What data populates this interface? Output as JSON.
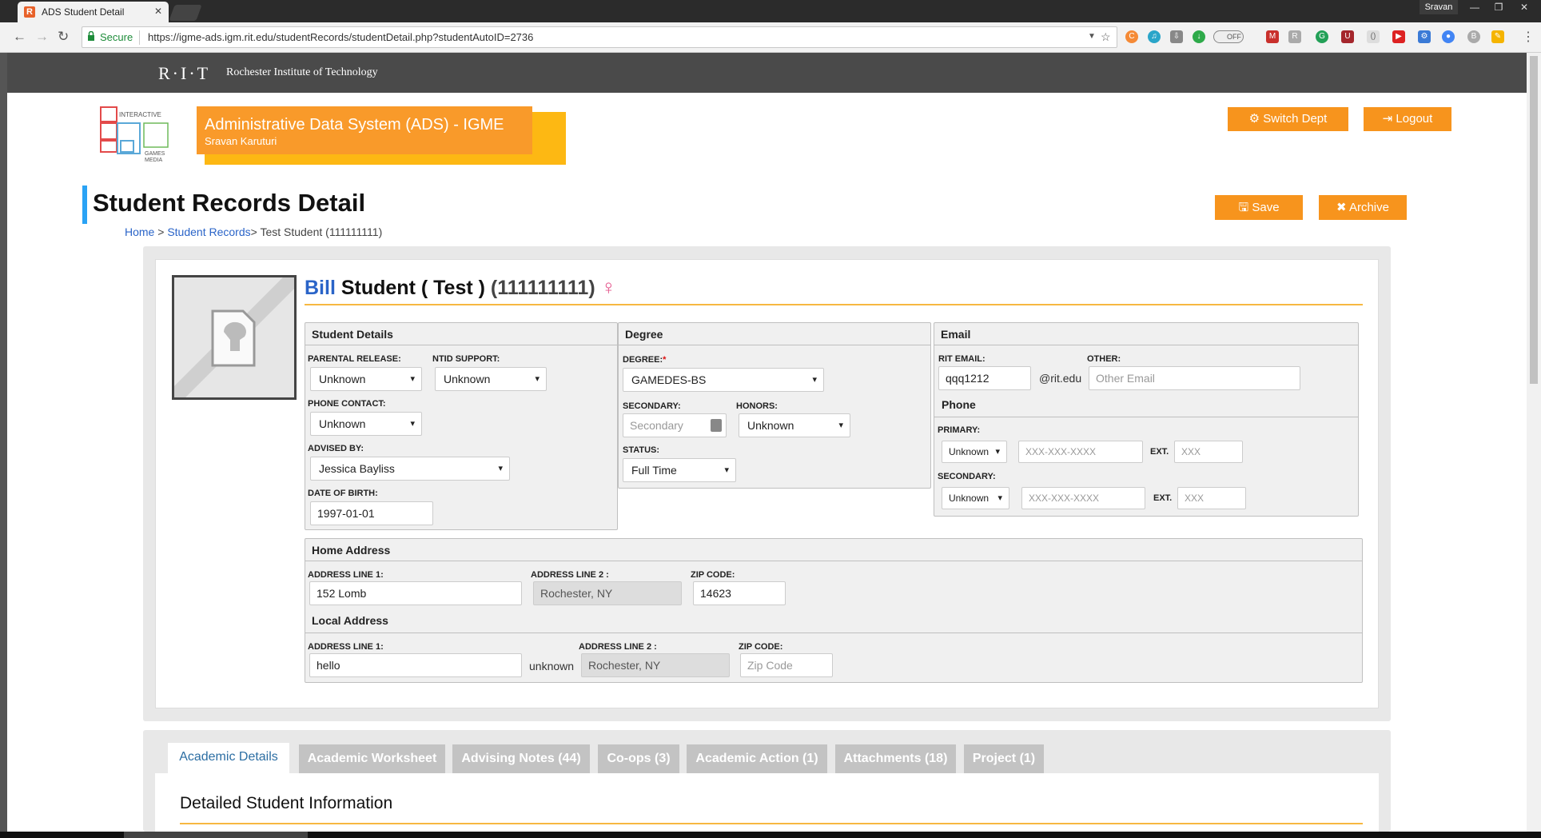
{
  "browser": {
    "tab_title": "ADS Student Detail",
    "tab_favicon": "R",
    "user": "Sravan",
    "secure_label": "Secure",
    "url": "https://igme-ads.igm.rit.edu/studentRecords/studentDetail.php?studentAutoID=2736",
    "toggle_label": "OFF"
  },
  "rit": {
    "logo": "R·I·T",
    "name": "Rochester Institute of Technology"
  },
  "header": {
    "igm_logo_lines": [
      "INTERACTIVE",
      "GAMES",
      "MEDIA"
    ],
    "system_title": "Administrative Data System (ADS) - IGME",
    "user_name": "Sravan Karuturi",
    "switch_dept": "Switch Dept",
    "logout": "Logout"
  },
  "page": {
    "title": "Student Records Detail",
    "breadcrumb_home": "Home",
    "breadcrumb_sep1": " > ",
    "breadcrumb_records": "Student Records",
    "breadcrumb_current": "> Test Student (111111111)",
    "save": "Save",
    "archive": "Archive"
  },
  "student": {
    "first_name": "Bill",
    "last_name": "Student ( Test )",
    "id": "(111111111)",
    "gender_symbol": "♀"
  },
  "student_details": {
    "heading": "Student Details",
    "parental_release_label": "PARENTAL RELEASE:",
    "parental_release": "Unknown",
    "ntid_support_label": "NTID SUPPORT:",
    "ntid_support": "Unknown",
    "phone_contact_label": "PHONE CONTACT:",
    "phone_contact": "Unknown",
    "advised_by_label": "ADVISED BY:",
    "advised_by": "Jessica Bayliss",
    "dob_label": "DATE OF BIRTH:",
    "dob": "1997-01-01"
  },
  "degree": {
    "heading": "Degree",
    "degree_label": "DEGREE:",
    "required_mark": "*",
    "degree": "GAMEDES-BS",
    "secondary_label": "SECONDARY:",
    "secondary_placeholder": "Secondary",
    "honors_label": "HONORS:",
    "honors": "Unknown",
    "status_label": "STATUS:",
    "status": "Full Time"
  },
  "email": {
    "heading": "Email",
    "rit_email_label": "RIT EMAIL:",
    "rit_email": "qqq1212",
    "domain": "@rit.edu",
    "other_label": "OTHER:",
    "other_placeholder": "Other Email"
  },
  "phone": {
    "heading": "Phone",
    "primary_label": "PRIMARY:",
    "primary_type": "Unknown",
    "primary_placeholder": "XXX-XXX-XXXX",
    "ext_label": "EXT.",
    "ext_placeholder": "XXX",
    "secondary_label": "SECONDARY:",
    "secondary_type": "Unknown",
    "secondary_placeholder": "XXX-XXX-XXXX"
  },
  "home_address": {
    "heading": "Home Address",
    "line1_label": "ADDRESS LINE 1:",
    "line1": "152 Lomb",
    "line2_label": "ADDRESS LINE 2 :",
    "line2": "Rochester, NY",
    "zip_label": "ZIP CODE:",
    "zip": "14623"
  },
  "local_address": {
    "heading": "Local Address",
    "line1_label": "ADDRESS LINE 1:",
    "line1": "hello",
    "between_text": "unknown",
    "line2_label": "ADDRESS LINE 2 :",
    "line2": "Rochester, NY",
    "zip_label": "ZIP CODE:",
    "zip_placeholder": "Zip Code"
  },
  "tabs": [
    {
      "label": "Academic Details"
    },
    {
      "label": "Academic Worksheet"
    },
    {
      "label": "Advising Notes (44)"
    },
    {
      "label": "Co-ops (3)"
    },
    {
      "label": "Academic Action (1)"
    },
    {
      "label": "Attachments (18)"
    },
    {
      "label": "Project (1)"
    }
  ],
  "detail": {
    "title": "Detailed Student Information"
  },
  "colors": {
    "accent_orange": "#f7941d",
    "accent_yellow": "#fdb813",
    "link_blue": "#2a64c8",
    "title_bar_blue": "#2aa3f5",
    "gender_pink": "#e5588e"
  }
}
